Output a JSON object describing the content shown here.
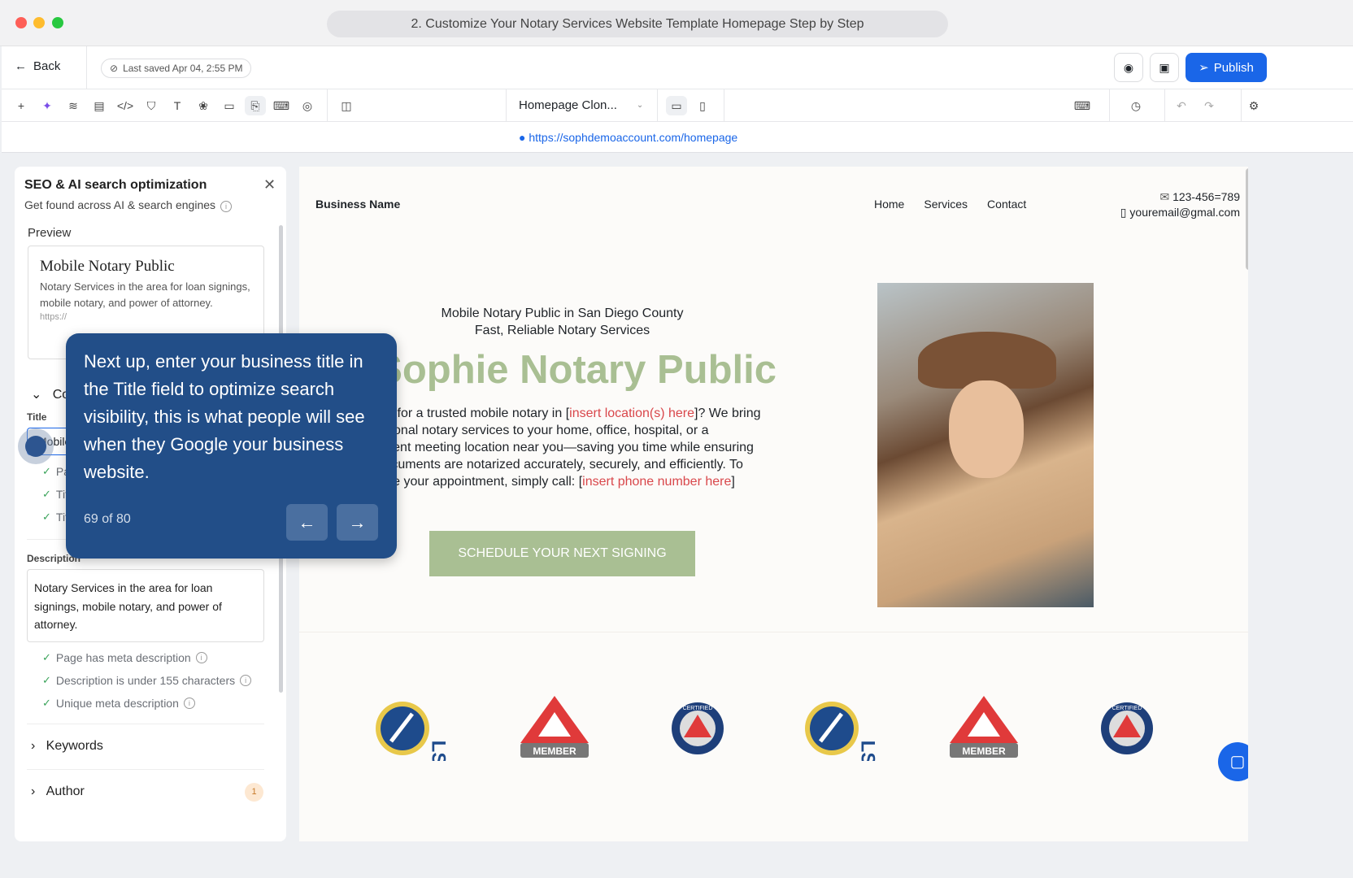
{
  "window": {
    "title": "2. Customize Your Notary Services Website Template Homepage Step by Step"
  },
  "header": {
    "back": "Back",
    "last_saved": "Last saved Apr 04, 2:55 PM",
    "publish": "Publish"
  },
  "toolbar": {
    "page_select": "Homepage Clon..."
  },
  "url": "https://sophdemoaccount.com/homepage",
  "panel": {
    "title": "SEO & AI search optimization",
    "subtitle": "Get found across AI & search engines",
    "preview_label": "Preview",
    "preview_title": "Mobile Notary Public",
    "preview_desc": "Notary Services in the area for loan signings, mobile notary, and power of attorney.",
    "preview_url": "https://",
    "section": "Co",
    "title_label": "Title",
    "title_value": "Mobile",
    "title_checks": [
      "Page",
      "Title",
      "Title"
    ],
    "description_label": "Description",
    "description_value": "Notary Services in the area for loan signings, mobile notary, and power of attorney.",
    "desc_checks": [
      "Page has meta description",
      "Description is under 155 characters",
      "Unique meta description"
    ],
    "keywords": "Keywords",
    "author": "Author",
    "author_badge": "1"
  },
  "tooltip": {
    "text": "Next up, enter your business title in the Title field to optimize search visibility, this is what people will see when they Google your business website.",
    "step": "69 of 80"
  },
  "site": {
    "business_name": "Business Name",
    "nav": [
      "Home",
      "Services",
      "Contact"
    ],
    "phone": "123-456=789",
    "email": "youremail@gmal.com",
    "kicker1": "Mobile Notary Public in San Diego County",
    "kicker2": "Fast, Reliable Notary Services",
    "headline": "Sophie Notary Public",
    "body_1": "Looking for a trusted mobile notary in [",
    "body_red1": "insert location(s) here",
    "body_2": "]? We bring professional notary services to your home, office, hospital, or a convenient meeting location near you—saving you time while ensuring your documents are notarized accurately, securely, and efficiently. To schedule your appointment, simply call: [",
    "body_red2": "insert phone number here",
    "body_3": "]",
    "cta": "SCHEDULE YOUR NEXT SIGNING",
    "badges": [
      "LSS",
      "MEMBER",
      "CERTIFIED",
      "LSS",
      "MEMBER",
      "CERTIFIED"
    ]
  },
  "colors": {
    "accent": "#1a66e8",
    "tooltip": "#224e88",
    "green": "#a9bf93"
  }
}
